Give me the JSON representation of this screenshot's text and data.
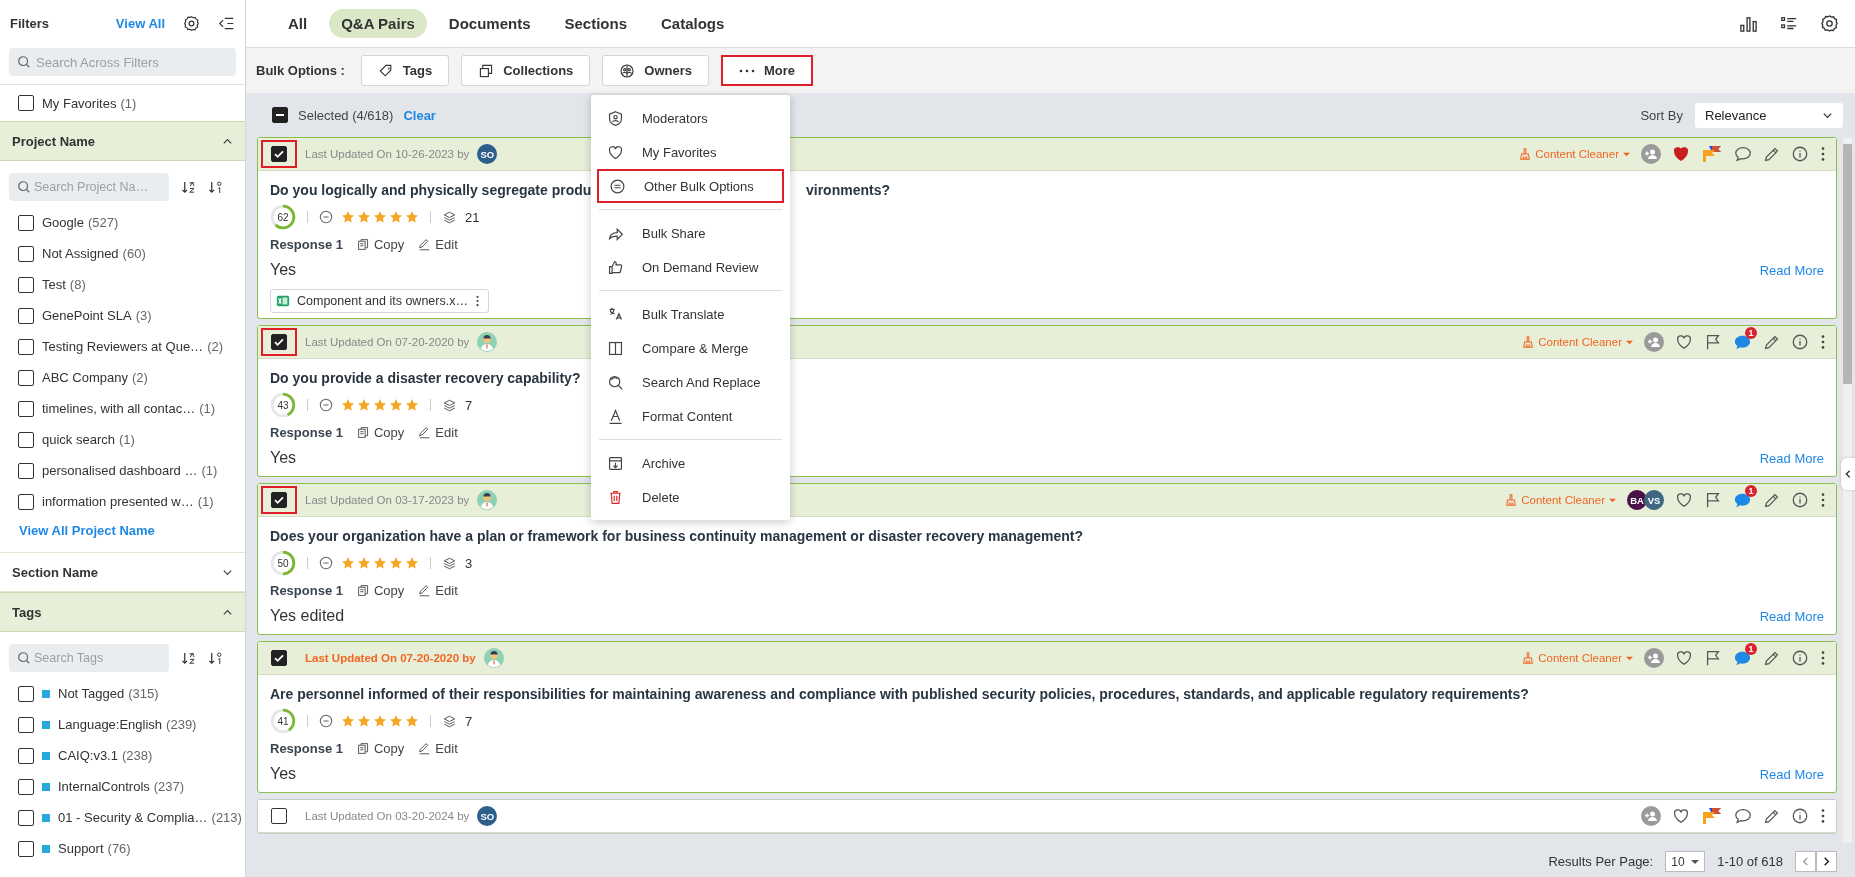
{
  "sidebar": {
    "title": "Filters",
    "view_all": "View All",
    "search": {
      "placeholder": "Search Across Filters"
    },
    "favorites": {
      "label": "My Favorites",
      "count": "(1)",
      "checked": false
    },
    "sections": [
      {
        "title": "Project Name",
        "expanded": true,
        "search": {
          "placeholder": "Search Project Na…"
        },
        "items": [
          {
            "label": "Google",
            "count": "(527)",
            "checked": false,
            "kind": "plain"
          },
          {
            "label": "Not Assigned",
            "count": "(60)",
            "checked": false,
            "kind": "plain"
          },
          {
            "label": "Test",
            "count": "(8)",
            "checked": false,
            "kind": "plain"
          },
          {
            "label": "GenePoint SLA",
            "count": "(3)",
            "checked": false,
            "kind": "plain"
          },
          {
            "label": "Testing Reviewers at Que…",
            "count": "(2)",
            "checked": false,
            "kind": "plain"
          },
          {
            "label": "ABC Company",
            "count": "(2)",
            "checked": false,
            "kind": "plain"
          },
          {
            "label": "timelines, with all contac…",
            "count": "(1)",
            "checked": false,
            "kind": "plain"
          },
          {
            "label": "quick search",
            "count": "(1)",
            "checked": false,
            "kind": "plain"
          },
          {
            "label": "personalised dashboard …",
            "count": "(1)",
            "checked": false,
            "kind": "plain"
          },
          {
            "label": "information presented w…",
            "count": "(1)",
            "checked": false,
            "kind": "plain"
          }
        ],
        "view_all": "View All Project Name"
      },
      {
        "title": "Section Name",
        "expanded": false
      },
      {
        "title": "Tags",
        "expanded": true,
        "search": {
          "placeholder": "Search Tags"
        },
        "items": [
          {
            "label": "Not Tagged",
            "count": "(315)",
            "checked": false,
            "kind": "tag"
          },
          {
            "label": "Language:English",
            "count": "(239)",
            "checked": false,
            "kind": "tag"
          },
          {
            "label": "CAIQ:v3.1",
            "count": "(238)",
            "checked": false,
            "kind": "tag"
          },
          {
            "label": "InternalControls",
            "count": "(237)",
            "checked": false,
            "kind": "tag"
          },
          {
            "label": "01 - Security & Complia…",
            "count": "(213)",
            "checked": false,
            "kind": "tag"
          },
          {
            "label": "Support",
            "count": "(76)",
            "checked": false,
            "kind": "tag"
          }
        ]
      }
    ]
  },
  "tabs": [
    {
      "label": "All",
      "selected": false
    },
    {
      "label": "Q&A Pairs",
      "selected": true
    },
    {
      "label": "Documents",
      "selected": false
    },
    {
      "label": "Sections",
      "selected": false
    },
    {
      "label": "Catalogs",
      "selected": false
    }
  ],
  "bulk": {
    "label": "Bulk Options :",
    "buttons": [
      {
        "label": "Tags",
        "highlighted": false
      },
      {
        "label": "Collections",
        "highlighted": false
      },
      {
        "label": "Owners",
        "highlighted": false
      },
      {
        "label": "More",
        "highlighted": true
      }
    ]
  },
  "menu": {
    "groups": [
      [
        {
          "label": "Moderators",
          "highlighted": false,
          "danger": false
        },
        {
          "label": "My Favorites",
          "highlighted": false,
          "danger": false
        },
        {
          "label": "Other Bulk Options",
          "highlighted": true,
          "danger": false
        }
      ],
      [
        {
          "label": "Bulk Share",
          "highlighted": false,
          "danger": false
        },
        {
          "label": "On Demand Review",
          "highlighted": false,
          "danger": false
        }
      ],
      [
        {
          "label": "Bulk Translate",
          "highlighted": false,
          "danger": false
        },
        {
          "label": "Compare & Merge",
          "highlighted": false,
          "danger": false
        },
        {
          "label": "Search And Replace",
          "highlighted": false,
          "danger": false
        },
        {
          "label": "Format Content",
          "highlighted": false,
          "danger": false
        }
      ],
      [
        {
          "label": "Archive",
          "highlighted": false,
          "danger": false
        },
        {
          "label": "Delete",
          "highlighted": false,
          "danger": true
        }
      ]
    ]
  },
  "selection": {
    "indeterminate": true,
    "text": "Selected (4/618)",
    "clear": "Clear"
  },
  "sort": {
    "label": "Sort By",
    "value": "Relevance"
  },
  "cards": [
    {
      "selected": true,
      "highlighted": true,
      "warning": false,
      "updated": "Last Updated On 10-26-2023 by",
      "author": {
        "kind": "initials",
        "initials": "SO"
      },
      "cleaner": "Content Cleaner",
      "favorite": true,
      "flagged": true,
      "question": "Do you logically and physically segregate produ",
      "question_tail": "vironments?",
      "score": "62",
      "level": 0.62,
      "stars": 5,
      "versions": "21",
      "response": "Response 1",
      "copy": "Copy",
      "edit": "Edit",
      "answer": "Yes",
      "attachment": "Component and its owners.x…",
      "read_more": "Read More"
    },
    {
      "selected": true,
      "highlighted": true,
      "warning": false,
      "updated": "Last Updated On 07-20-2020 by",
      "author": {
        "kind": "figure"
      },
      "cleaner": "Content Cleaner",
      "favorite": false,
      "flagged": false,
      "comment_count": "1",
      "question": "Do you provide a disaster recovery capability?",
      "score": "43",
      "level": 0.43,
      "stars": 5,
      "versions": "7",
      "response": "Response 1",
      "copy": "Copy",
      "edit": "Edit",
      "answer": "Yes",
      "read_more": "Read More"
    },
    {
      "selected": true,
      "highlighted": true,
      "warning": false,
      "updated": "Last Updated On 03-17-2023 by",
      "author": {
        "kind": "figure"
      },
      "cleaner": "Content Cleaner",
      "owners": [
        {
          "initials": "BA",
          "color": "#4b1248"
        },
        {
          "initials": "VS",
          "color": "#3e6782"
        }
      ],
      "favorite": false,
      "flagged": false,
      "comment_count": "1",
      "question": "Does your organization have a plan or framework for business continuity management or disaster recovery management?",
      "score": "50",
      "level": 0.5,
      "stars": 5,
      "versions": "3",
      "response": "Response 1",
      "copy": "Copy",
      "edit": "Edit",
      "answer": "Yes edited",
      "read_more": "Read More"
    },
    {
      "selected": true,
      "highlighted": false,
      "warning": true,
      "updated": "Last Updated On 07-20-2020 by",
      "author": {
        "kind": "figure"
      },
      "cleaner": "Content Cleaner",
      "favorite": false,
      "flagged": false,
      "comment_count": "1",
      "question": "Are personnel informed of their responsibilities for maintaining awareness and compliance with published security policies, procedures, standards, and applicable regulatory requirements?",
      "score": "41",
      "level": 0.41,
      "stars": 5,
      "versions": "7",
      "response": "Response 1",
      "copy": "Copy",
      "edit": "Edit",
      "answer": "Yes",
      "read_more": "Read More"
    },
    {
      "selected": false,
      "highlighted": false,
      "warning": false,
      "updated": "Last Updated On 03-20-2024 by",
      "author": {
        "kind": "initials",
        "initials": "SO"
      },
      "favorite": false,
      "flagged": true
    }
  ],
  "footer": {
    "label": "Results Per Page:",
    "per_page": "10",
    "range": "1-10 of 618"
  }
}
